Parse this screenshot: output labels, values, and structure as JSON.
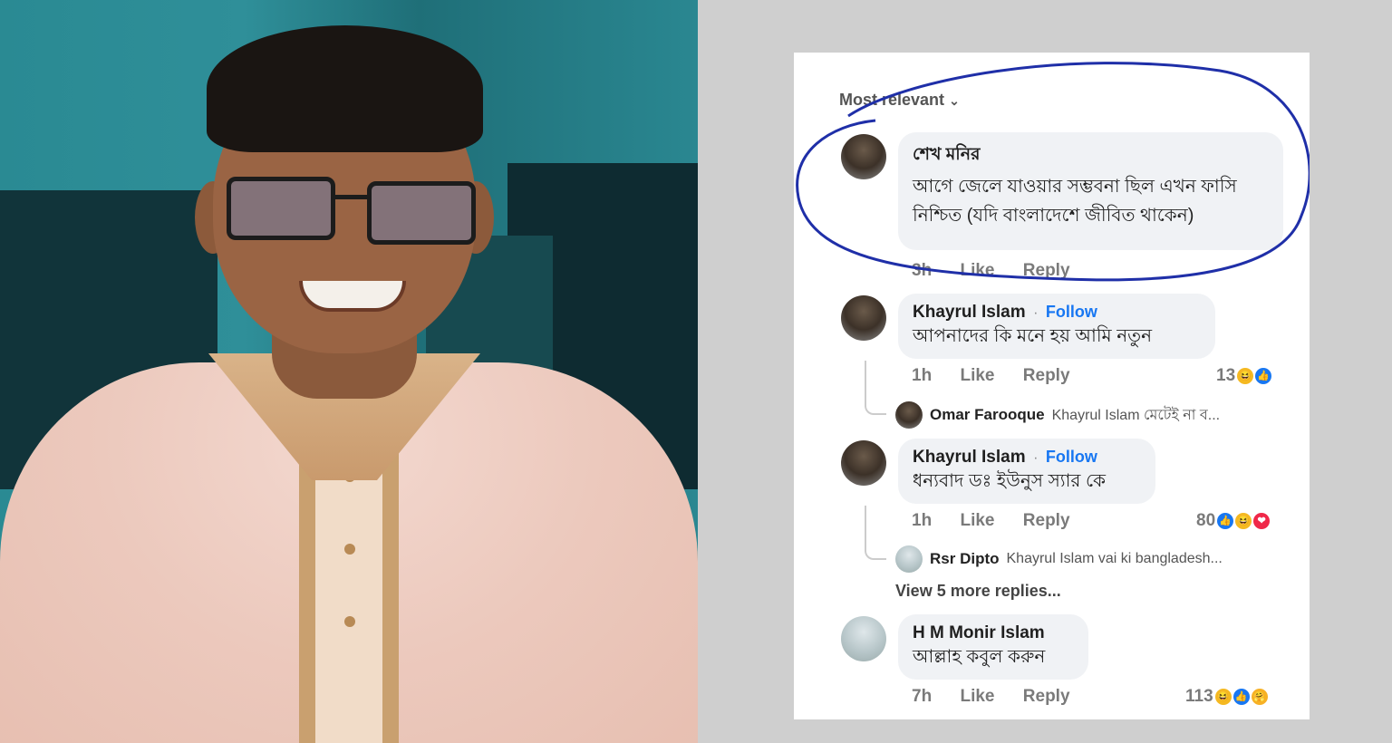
{
  "sort_label": "Most relevant",
  "sort_icon": "chevron-down-icon",
  "comments": [
    {
      "name": "শেখ মনির",
      "text": "আগে জেলে যাওয়ার সম্ভবনা ছিল এখন ফাসি নিশ্চিত (যদি বাংলাদেশে জীবিত থাকেন)",
      "time": "3h",
      "like": "Like",
      "reply": "Reply"
    },
    {
      "name": "Khayrul Islam",
      "follow": "Follow",
      "text": "আপনাদের কি মনে হয় আমি নতুন",
      "time": "1h",
      "like": "Like",
      "reply": "Reply",
      "reactions_count": "13",
      "reaction_icons": [
        "haha",
        "like"
      ],
      "reply_preview": {
        "name": "Omar Farooque",
        "text": "Khayrul Islam মেটেই না ব..."
      }
    },
    {
      "name": "Khayrul Islam",
      "follow": "Follow",
      "text": "ধন্যবাদ ডঃ ইউনুস স্যার কে",
      "time": "1h",
      "like": "Like",
      "reply": "Reply",
      "reactions_count": "80",
      "reaction_icons": [
        "like",
        "haha",
        "love"
      ],
      "reply_preview": {
        "name": "Rsr Dipto",
        "text": "Khayrul Islam vai ki bangladesh..."
      },
      "more_replies": "View 5 more replies..."
    },
    {
      "name": "H M Monir Islam",
      "text": "আল্লাহ কবুল করুন",
      "time": "7h",
      "like": "Like",
      "reply": "Reply",
      "reactions_count": "113",
      "reaction_icons": [
        "haha",
        "like",
        "care"
      ]
    }
  ],
  "colors": {
    "follow": "#1877f2",
    "bubble": "#f0f2f5",
    "highlight_circle": "#1f2fa8"
  }
}
